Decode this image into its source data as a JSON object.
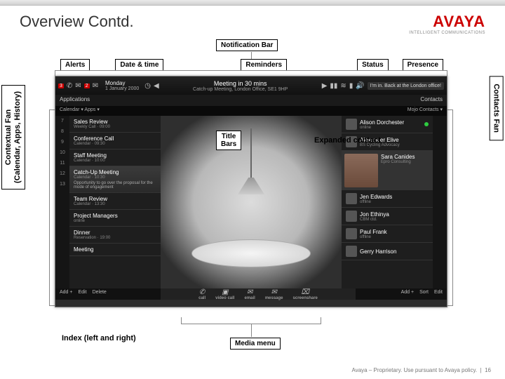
{
  "slide": {
    "title": "Overview Contd.",
    "brand": "AVAYA",
    "brand_sub": "INTELLIGENT COMMUNICATIONS",
    "footer": "Avaya – Proprietary. Use pursuant to Avaya policy.",
    "page_num": "16"
  },
  "labels": {
    "notification_bar": "Notification Bar",
    "alerts": "Alerts",
    "date_time": "Date & time",
    "reminders": "Reminders",
    "status": "Status",
    "presence": "Presence",
    "title_bars": "Title\nBars",
    "expanded_contact": "Expanded contact",
    "index": "Index (left and right)",
    "media_menu": "Media menu",
    "contextual_fan": "Contextual Fan\n(Calendar, Apps, History)",
    "contacts_fan": "Contacts Fan"
  },
  "notif": {
    "badge1": "3",
    "badge2": "2",
    "date_line1": "Monday",
    "date_line2": "1 January 2000",
    "reminder_line1": "Meeting in 30 mins",
    "reminder_line2": "Catch-up Meeting, London Office, SE1 9HP",
    "presence_text": "I'm in. Back at the London office!"
  },
  "panels": {
    "apps_header": "Applications",
    "apps_tabs": "Calendar ▾  Apps ▾",
    "contacts_header": "Contacts",
    "contacts_tabs": "Mojo Contacts ▾"
  },
  "index_numbers": [
    "7",
    "8",
    "9",
    "10",
    "11",
    "12",
    "13"
  ],
  "apps": [
    {
      "t": "Sales Review",
      "s": "Weekly Call · 09:00"
    },
    {
      "t": "Conference Call",
      "s": "Calendar · 09:30"
    },
    {
      "t": "Staff Meeting",
      "s": "Calendar · 10:00"
    },
    {
      "t": "Catch-Up Meeting",
      "s": "Calendar · 10:30",
      "sel": true,
      "extra": "Opportunity to go over the proposal for the mode of engagement"
    },
    {
      "t": "Team Review",
      "s": "Calendar · 13:30"
    },
    {
      "t": "Project Managers",
      "s": "online"
    },
    {
      "t": "Dinner",
      "s": "Reservation · 19:00"
    },
    {
      "t": "Meeting",
      "s": ""
    }
  ],
  "contacts": [
    {
      "t": "Alison Dorchester",
      "s": "online"
    },
    {
      "t": "Alexander Elive",
      "s": "BS Cycling Advocacy"
    },
    {
      "t": "Sara Canides",
      "s": "Epro Consulting",
      "expanded": true
    },
    {
      "t": "Jen Edwards",
      "s": "offline"
    },
    {
      "t": "Jon Ethinya",
      "s": "CBM ctd."
    },
    {
      "t": "Paul Frank",
      "s": "offline"
    },
    {
      "t": "Gerry Harrison",
      "s": ""
    }
  ],
  "footer_left": {
    "add": "Add +",
    "edit": "Edit",
    "delete": "Delete"
  },
  "footer_right": {
    "add": "Add +",
    "sort": "Sort",
    "edit": "Edit"
  },
  "media": {
    "call": "call",
    "video": "video call",
    "email": "email",
    "message": "message",
    "screenshare": "screenshare"
  }
}
